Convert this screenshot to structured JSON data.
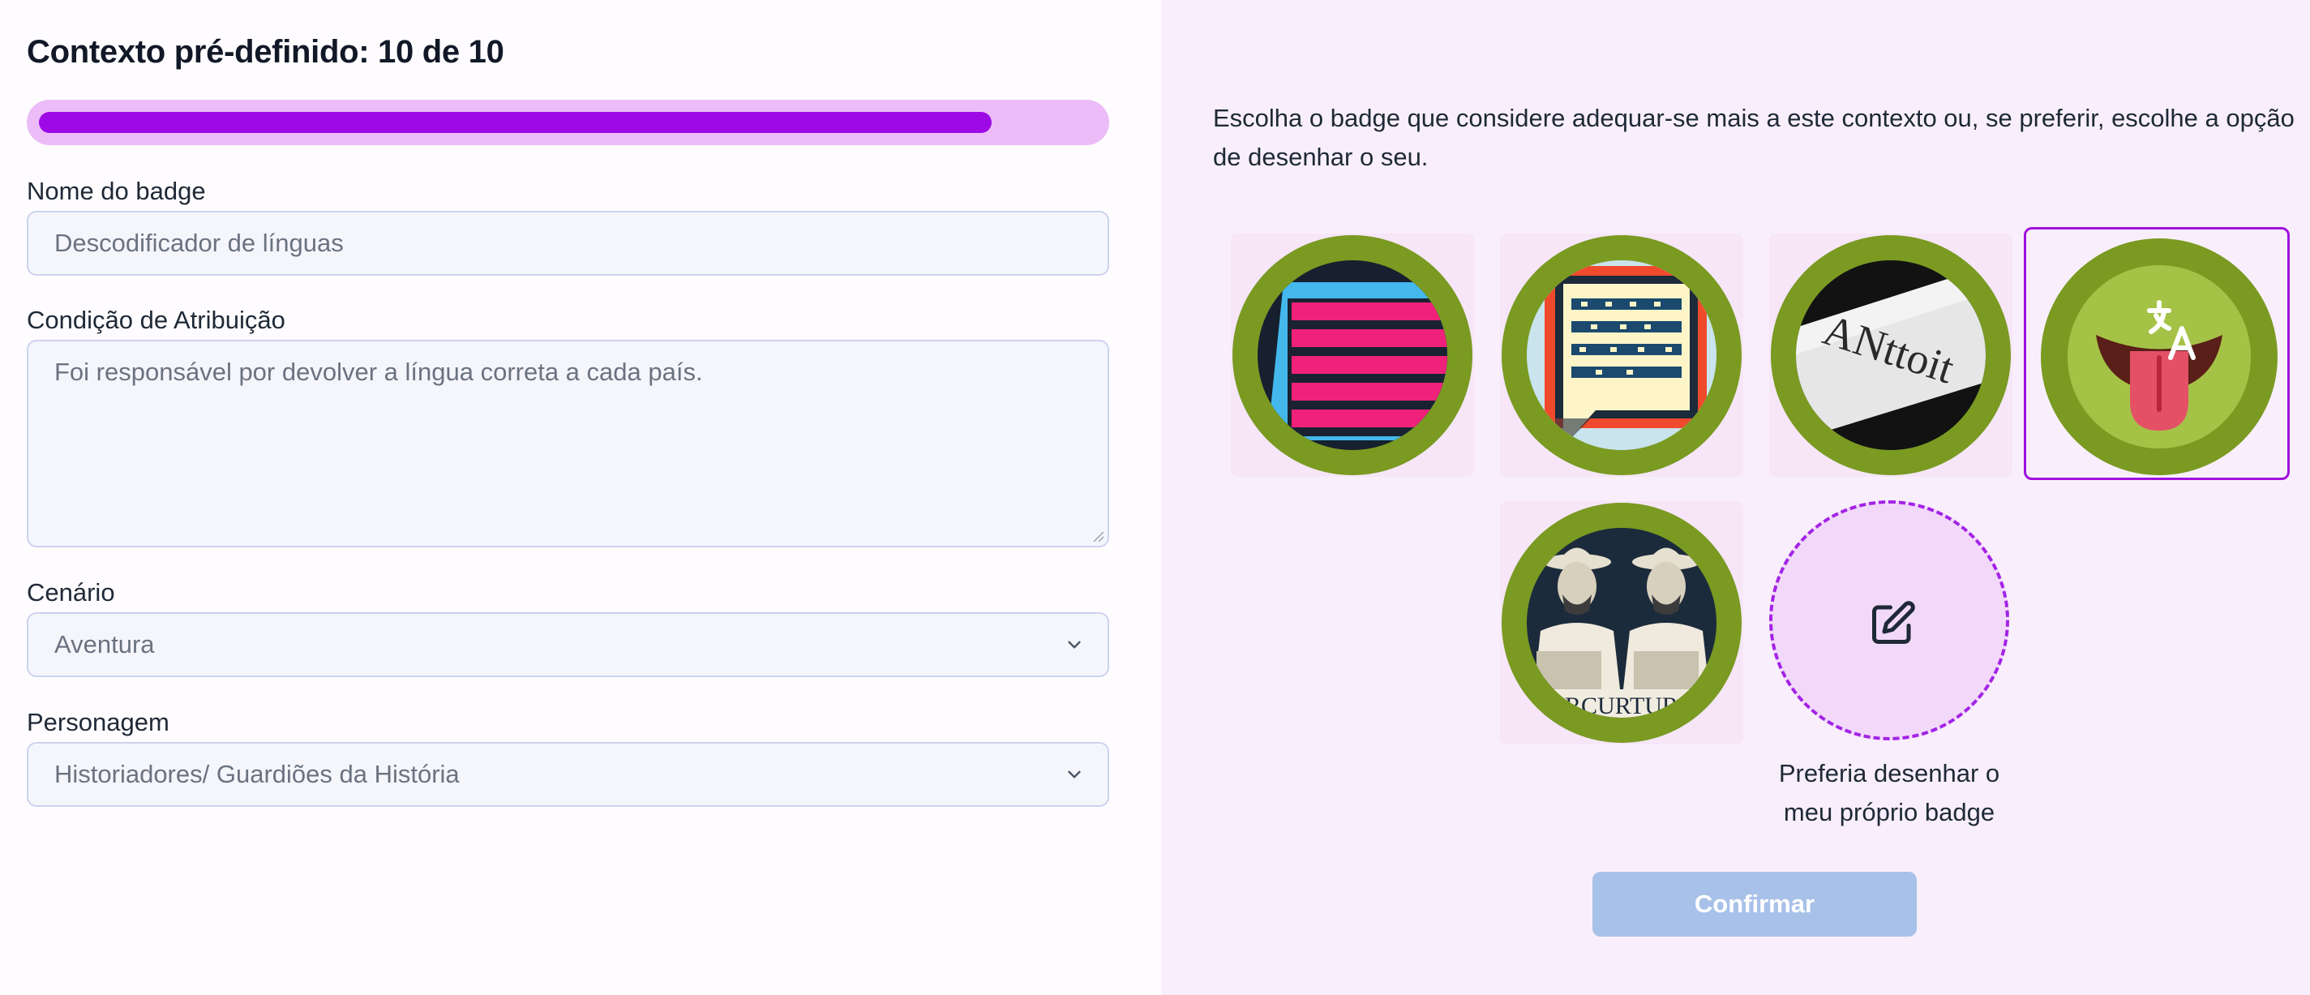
{
  "form": {
    "title": "Contexto pré-definido: 10 de 10",
    "progress_fraction": 0.9,
    "badge_name": {
      "label": "Nome do badge",
      "value": "Descodificador de línguas"
    },
    "condition": {
      "label": "Condição de Atribuição",
      "value": "Foi responsável por devolver a língua correta a cada país."
    },
    "scenario": {
      "label": "Cenário",
      "selected": "Aventura"
    },
    "character": {
      "label": "Personagem",
      "selected": "Historiadores/ Guardiões da História"
    }
  },
  "picker": {
    "instructions": "Escolha o badge que considere adequar-se mais a este contexto ou, se preferir, escolhe a opção de desenhar o seu.",
    "badges": [
      {
        "icon": "stacked-bars-badge-icon",
        "selected": false
      },
      {
        "icon": "pixel-speech-bubble-badge-icon",
        "selected": false
      },
      {
        "icon": "stamped-text-badge-icon",
        "selected": false,
        "text": "ANttoit"
      },
      {
        "icon": "tongue-translate-badge-icon",
        "selected": true
      },
      {
        "icon": "explorers-badge-icon",
        "selected": false,
        "text": "RCURTUR"
      }
    ],
    "draw_own_label": "Preferia desenhar o meu próprio badge",
    "confirm_label": "Confirmar"
  },
  "colors": {
    "accent": "#9d0ae6",
    "badge_ring": "#7a9a22",
    "confirm_disabled": "#a8c1e9",
    "panel_bg": "#f9effc"
  }
}
